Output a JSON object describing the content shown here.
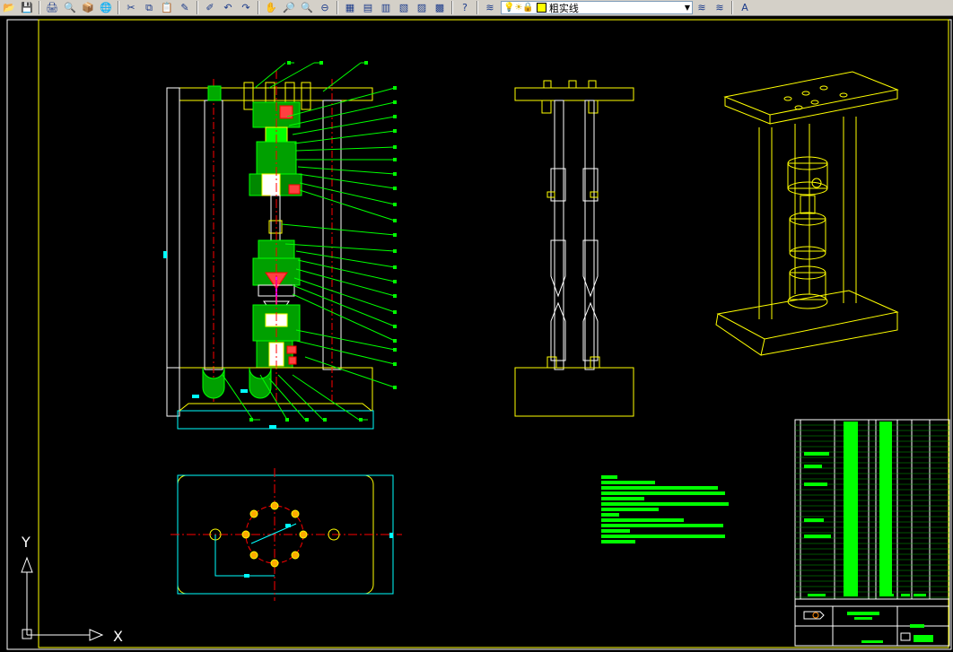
{
  "toolbar": {
    "buttons_left": [
      {
        "name": "open-icon",
        "glyph": "📂"
      },
      {
        "name": "save-icon",
        "glyph": "💾"
      },
      {
        "name": "print-icon",
        "glyph": "🖨"
      },
      {
        "name": "plot-preview-icon",
        "glyph": "🔍"
      },
      {
        "name": "publish-icon",
        "glyph": "📦"
      },
      {
        "name": "web-icon",
        "glyph": "🌐"
      },
      {
        "name": "cut-icon",
        "glyph": "✂"
      },
      {
        "name": "copy-icon",
        "glyph": "⧉"
      },
      {
        "name": "paste-icon",
        "glyph": "📋"
      },
      {
        "name": "match-properties-icon",
        "glyph": "✎"
      },
      {
        "name": "block-editor-icon",
        "glyph": "✐"
      },
      {
        "name": "undo-icon",
        "glyph": "↶"
      },
      {
        "name": "redo-icon",
        "glyph": "↷"
      },
      {
        "name": "pan-icon",
        "glyph": "✋"
      },
      {
        "name": "zoom-realtime-icon",
        "glyph": "🔎"
      },
      {
        "name": "zoom-window-icon",
        "glyph": "🔍"
      },
      {
        "name": "zoom-previous-icon",
        "glyph": "⊖"
      },
      {
        "name": "properties-icon",
        "glyph": "▦"
      },
      {
        "name": "design-center-icon",
        "glyph": "▤"
      },
      {
        "name": "tool-palettes-icon",
        "glyph": "▥"
      },
      {
        "name": "sheet-set-icon",
        "glyph": "▧"
      },
      {
        "name": "markup-icon",
        "glyph": "▨"
      },
      {
        "name": "calculator-icon",
        "glyph": "▩"
      },
      {
        "name": "help-icon",
        "glyph": "?"
      }
    ],
    "layer_manager_icon": "≋",
    "layer_state_icons": [
      "💡",
      "☀",
      "🔒"
    ],
    "layer_name": "粗实线",
    "layer_dropdown_arrow": "▼",
    "buttons_right": [
      {
        "name": "make-current-layer-icon",
        "glyph": "≋"
      },
      {
        "name": "layer-previous-icon",
        "glyph": "≋"
      }
    ],
    "text-style-icon": "A"
  },
  "ucs": {
    "x_label": "X",
    "y_label": "Y"
  },
  "colors": {
    "background": "#000000",
    "green": "#00ff00",
    "yellow": "#ffff00",
    "cyan": "#00ffff",
    "red": "#ff0000",
    "magenta": "#ff00ff",
    "white": "#ffffff"
  }
}
